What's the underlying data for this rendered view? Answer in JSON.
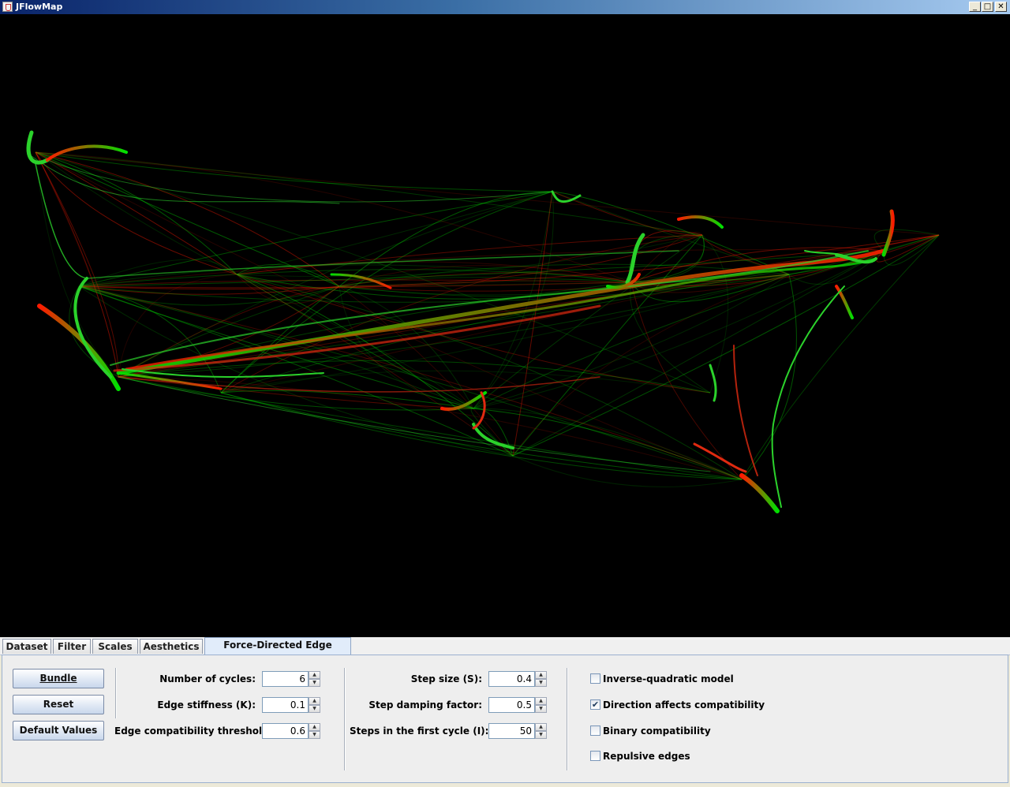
{
  "window": {
    "title": "JFlowMap",
    "minimize_glyph": "_",
    "maximize_glyph": "□",
    "close_glyph": "✕"
  },
  "tabs": [
    {
      "label": "Dataset",
      "active": false
    },
    {
      "label": "Filter",
      "active": false
    },
    {
      "label": "Scales",
      "active": false
    },
    {
      "label": "Aesthetics",
      "active": false
    },
    {
      "label": "Force-Directed Edge Bundling",
      "active": true
    }
  ],
  "buttons": {
    "bundle": "Bundle",
    "reset": "Reset",
    "default_values": "Default Values"
  },
  "params_left": [
    {
      "label": "Number of cycles:",
      "value": "6"
    },
    {
      "label": "Edge stiffness (K):",
      "value": "0.1"
    },
    {
      "label": "Edge compatibility threshold:",
      "value": "0.6"
    }
  ],
  "params_mid": [
    {
      "label": "Step size (S):",
      "value": "0.4"
    },
    {
      "label": "Step damping factor:",
      "value": "0.5"
    },
    {
      "label": "Steps in the first cycle (I):",
      "value": "50"
    }
  ],
  "options": [
    {
      "label": "Inverse-quadratic model",
      "checked": false
    },
    {
      "label": "Direction affects compatibility",
      "checked": true
    },
    {
      "label": "Binary compatibility",
      "checked": false
    },
    {
      "label": "Repulsive edges",
      "checked": false
    }
  ],
  "colors": {
    "canvas_background": "#000000",
    "flow_start": "#ff1a00",
    "flow_end": "#00e000"
  },
  "icons": {
    "app": "java-cup-icon",
    "up_arrow": "▲",
    "down_arrow": "▼",
    "check": "✔"
  }
}
